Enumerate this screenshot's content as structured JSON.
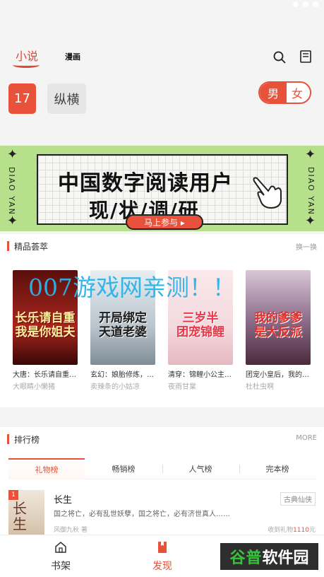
{
  "header": {
    "tab_novel": "小说",
    "tab_comic": "漫画",
    "categories": [
      "17",
      "纵横"
    ],
    "gender": {
      "male": "男",
      "female": "女",
      "selected": "男"
    }
  },
  "banner": {
    "side_text": "DIAO YAN",
    "line1": "中国数字阅读用户",
    "line2": "现/状/调/研",
    "button": "马上参与 ▸"
  },
  "featured": {
    "title": "精品荟萃",
    "more": "换一换",
    "books": [
      {
        "title": "大唐：长乐请自重…",
        "author": "大眼睛小懒猪",
        "cover_text": "长乐请自重\n我是你姐夫",
        "cover_color": "#a8261e"
      },
      {
        "title": "玄幻：娘胎修炼，…",
        "author": "卖辣条的小姑凉",
        "cover_text": "开局绑定\n天道老婆",
        "cover_color": "#cfd6dc"
      },
      {
        "title": "清穿：锦鲤小公主…",
        "author": "夜雨甘棠",
        "cover_text": "三岁半\n团宠锦鲤",
        "cover_color": "#f3d9de"
      },
      {
        "title": "团宠小皇后，我的…",
        "author": "杜杜虫啊",
        "cover_text": "我的爹爹\n是大反派",
        "cover_color": "#8a6a88"
      }
    ]
  },
  "watermark": "007游戏网亲测！！",
  "ranking": {
    "title": "排行榜",
    "more": "MORE",
    "tabs": [
      "礼物榜",
      "畅销榜",
      "人气榜",
      "完本榜"
    ],
    "active_tab": "礼物榜",
    "items": [
      {
        "rank": "1",
        "title": "长生",
        "genre": "古典仙侠",
        "desc": "国之将亡，必有乱世妖孽，国之将亡，必有济世真人……",
        "author": "风御九秋 著",
        "gift_prefix": "收到礼物",
        "gift_num": "1110",
        "gift_suffix": "元",
        "cover_text": "长\n生"
      }
    ]
  },
  "bottom_nav": {
    "items": [
      "书架",
      "发现"
    ],
    "active": "发现"
  },
  "logo": {
    "part1": "谷普",
    "part2": "软件园"
  },
  "colors": {
    "accent": "#e8523a",
    "banner_bg": "#b6e08c",
    "watermark": "#2bb3e8"
  }
}
